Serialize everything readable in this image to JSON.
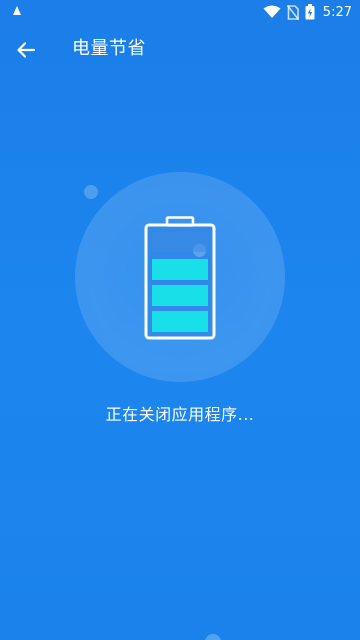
{
  "status_bar": {
    "time": "5:27",
    "icons": [
      "notification-icon",
      "wifi-icon",
      "no-sim-icon",
      "battery-charging-icon"
    ]
  },
  "app_bar": {
    "title": "电量节省",
    "back_icon": "arrow-left-icon"
  },
  "main": {
    "status_text": "正在关闭应用程序...",
    "battery_icon": "battery-icon",
    "battery_level_bars": 3,
    "battery_level_total": 4
  },
  "colors": {
    "background": "#1b7ee9",
    "battery_fill": "#19e0e8",
    "battery_outline": "#ffffff"
  }
}
